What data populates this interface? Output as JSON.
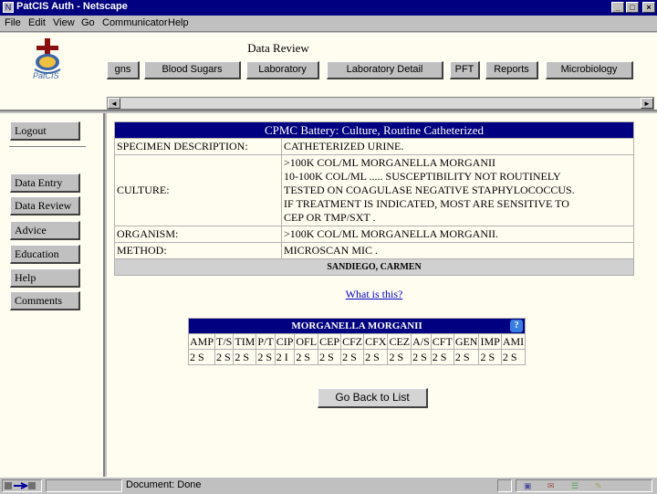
{
  "window": {
    "title": "PatCIS Auth - Netscape",
    "minimize": "_",
    "maximize": "□",
    "close": "×"
  },
  "menu": [
    "File",
    "Edit",
    "View",
    "Go",
    "Communicator",
    "Help"
  ],
  "header": {
    "page_title": "Data Review",
    "logo_text": "PatCIS"
  },
  "tabs": [
    "gns",
    "Blood Sugars",
    "Laboratory",
    "Laboratory Detail",
    "PFT",
    "Reports",
    "Microbiology"
  ],
  "sidebar": {
    "logout": "Logout",
    "items": [
      "Data Entry",
      "Data Review",
      "Advice",
      "Education",
      "Help",
      "Comments"
    ]
  },
  "culture": {
    "title": "CPMC Battery: Culture, Routine Catheterized",
    "rows": [
      {
        "label": "SPECIMEN DESCRIPTION:",
        "value": "CATHETERIZED URINE."
      },
      {
        "label": "CULTURE:",
        "lines": [
          ">100K COL/ML MORGANELLA MORGANII",
          "10-100K COL/ML ..... SUSCEPTIBILITY NOT ROUTINELY",
          "TESTED ON COAGULASE NEGATIVE STAPHYLOCOCCUS.",
          "IF TREATMENT IS INDICATED, MOST ARE SENSITIVE TO",
          "CEP OR TMP/SXT ."
        ]
      },
      {
        "label": "ORGANISM:",
        "value": ">100K COL/ML MORGANELLA MORGANII."
      },
      {
        "label": "METHOD:",
        "value": "MICROSCAN MIC ."
      }
    ],
    "patient": "SANDIEGO, CARMEN",
    "what_link": "What is this?"
  },
  "susceptibility": {
    "organism": "MORGANELLA MORGANII",
    "antibiotics": [
      "AMP",
      "T/S",
      "TIM",
      "P/T",
      "CIP",
      "OFL",
      "CEP",
      "CFZ",
      "CFX",
      "CEZ",
      "A/S",
      "CFT",
      "GEN",
      "IMP",
      "AMI"
    ],
    "results": [
      "2 S",
      "2 S",
      "2 S",
      "2 S",
      "2 I",
      "2 S",
      "2 S",
      "2 S",
      "2 S",
      "2 S",
      "2 S",
      "2 S",
      "2 S",
      "2 S",
      "2 S"
    ]
  },
  "back_button": "Go Back to List",
  "status": {
    "text": "Document: Done"
  },
  "scroll": {
    "left": "◄",
    "right": "►"
  }
}
